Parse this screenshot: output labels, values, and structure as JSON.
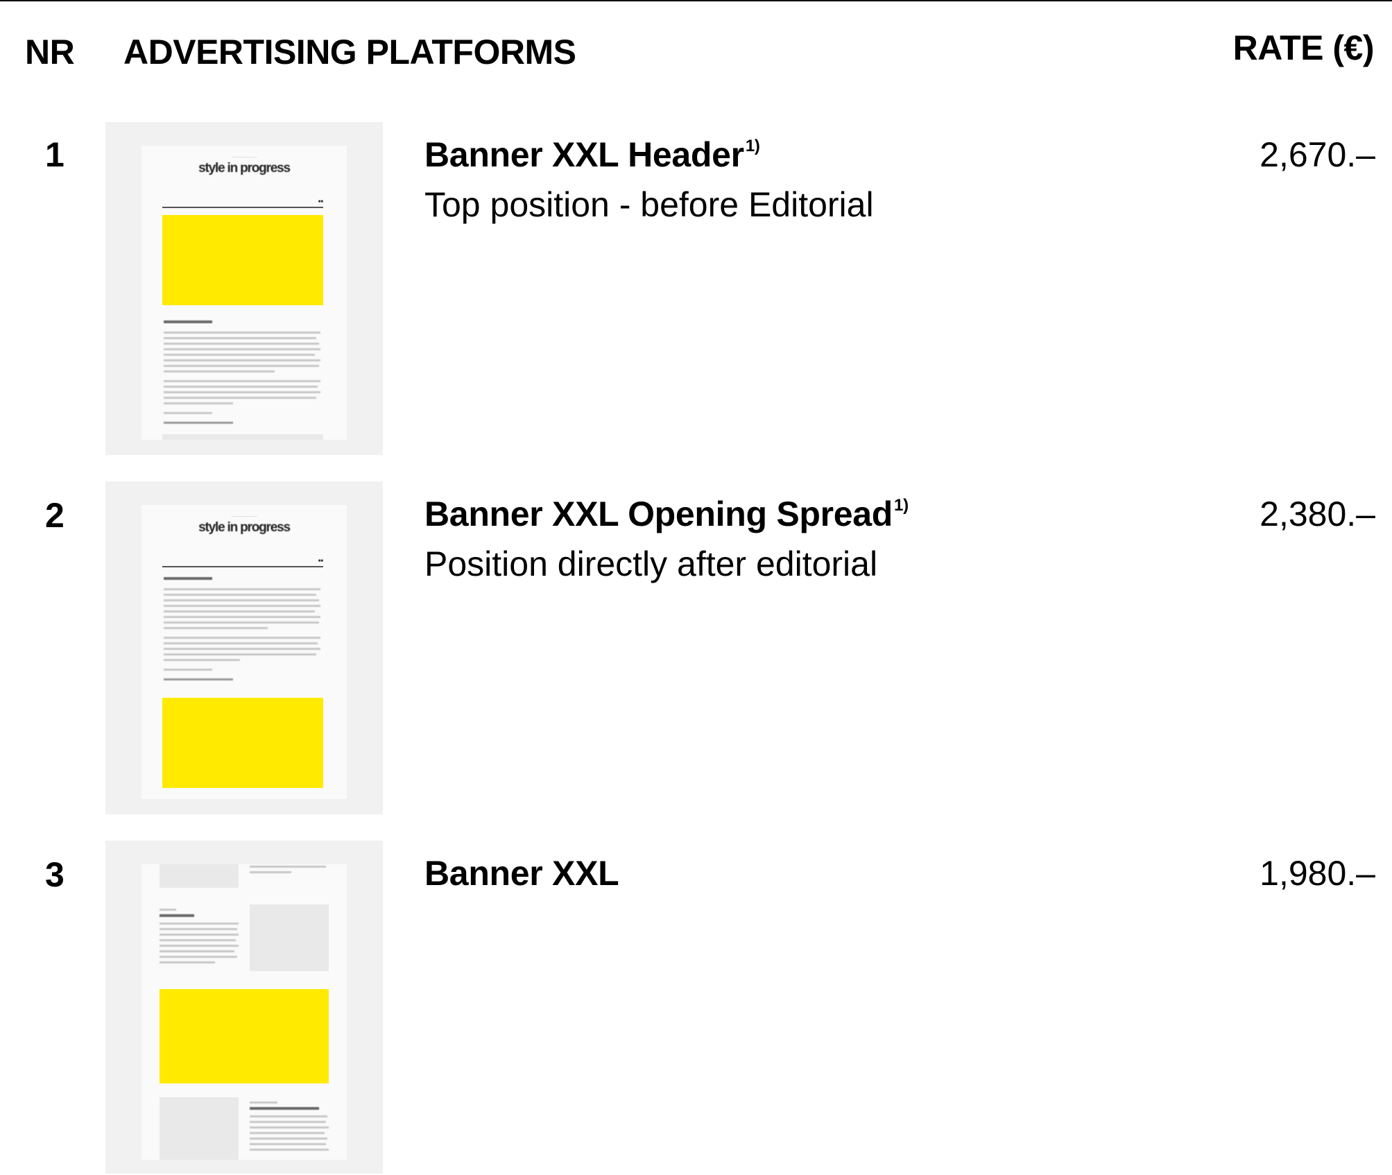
{
  "header": {
    "nr": "NR",
    "platforms": "ADVERTISING PLATFORMS",
    "rate": "RATE (€)"
  },
  "rows": [
    {
      "nr": "1",
      "title": "Banner XXL Header",
      "footnote": "1)",
      "description": "Top position - before Editorial",
      "rate": "2,670.–"
    },
    {
      "nr": "2",
      "title": "Banner XXL Opening Spread",
      "footnote": "1)",
      "description": "Position directly after editorial",
      "rate": "2,380.–"
    },
    {
      "nr": "3",
      "title": "Banner XXL",
      "footnote": "",
      "description": "",
      "rate": "1,980.–"
    }
  ],
  "thumbnail": {
    "logo": "style in progress",
    "accent_color": "#ffea00",
    "banner_label": "Banner",
    "background": "#f1f1f1"
  }
}
